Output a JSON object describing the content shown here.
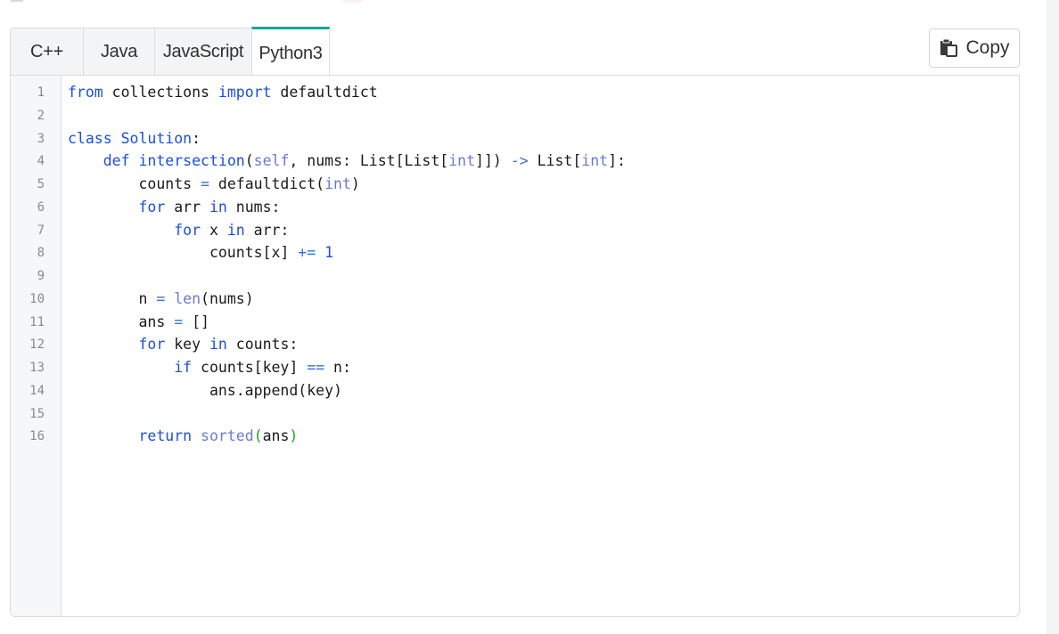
{
  "tabs": [
    {
      "label": "C++",
      "active": false
    },
    {
      "label": "Java",
      "active": false
    },
    {
      "label": "JavaScript",
      "active": false
    },
    {
      "label": "Python3",
      "active": true
    }
  ],
  "copy_button": {
    "label": "Copy",
    "icon": "clipboard-copy-icon"
  },
  "colors": {
    "accent_tab": "#1aa3a3",
    "keyword": "#1c4fd8",
    "builtin": "#6b79d6",
    "bracket_match": "#1ba21b"
  },
  "code": {
    "language": "Python3",
    "lines": [
      [
        {
          "t": "from",
          "c": "kw"
        },
        {
          "t": " collections ",
          "c": "plain"
        },
        {
          "t": "import",
          "c": "kw"
        },
        {
          "t": " defaultdict",
          "c": "plain"
        }
      ],
      [],
      [
        {
          "t": "class",
          "c": "kw"
        },
        {
          "t": " ",
          "c": "plain"
        },
        {
          "t": "Solution",
          "c": "kw"
        },
        {
          "t": ":",
          "c": "plain"
        }
      ],
      [
        {
          "t": "    ",
          "c": "plain"
        },
        {
          "t": "def",
          "c": "kw"
        },
        {
          "t": " ",
          "c": "plain"
        },
        {
          "t": "intersection",
          "c": "kw"
        },
        {
          "t": "(",
          "c": "plain"
        },
        {
          "t": "self",
          "c": "self"
        },
        {
          "t": ", nums: List[List[",
          "c": "plain"
        },
        {
          "t": "int",
          "c": "bi"
        },
        {
          "t": "]]) ",
          "c": "plain"
        },
        {
          "t": "->",
          "c": "op"
        },
        {
          "t": " List[",
          "c": "plain"
        },
        {
          "t": "int",
          "c": "bi"
        },
        {
          "t": "]:",
          "c": "plain"
        }
      ],
      [
        {
          "t": "        counts ",
          "c": "plain"
        },
        {
          "t": "=",
          "c": "op"
        },
        {
          "t": " defaultdict(",
          "c": "plain"
        },
        {
          "t": "int",
          "c": "bi"
        },
        {
          "t": ")",
          "c": "plain"
        }
      ],
      [
        {
          "t": "        ",
          "c": "plain"
        },
        {
          "t": "for",
          "c": "kw"
        },
        {
          "t": " arr ",
          "c": "plain"
        },
        {
          "t": "in",
          "c": "kw"
        },
        {
          "t": " nums:",
          "c": "plain"
        }
      ],
      [
        {
          "t": "            ",
          "c": "plain"
        },
        {
          "t": "for",
          "c": "kw"
        },
        {
          "t": " x ",
          "c": "plain"
        },
        {
          "t": "in",
          "c": "kw"
        },
        {
          "t": " arr:",
          "c": "plain"
        }
      ],
      [
        {
          "t": "                counts[x] ",
          "c": "plain"
        },
        {
          "t": "+=",
          "c": "op"
        },
        {
          "t": " ",
          "c": "plain"
        },
        {
          "t": "1",
          "c": "num"
        }
      ],
      [],
      [
        {
          "t": "        n ",
          "c": "plain"
        },
        {
          "t": "=",
          "c": "op"
        },
        {
          "t": " ",
          "c": "plain"
        },
        {
          "t": "len",
          "c": "bi"
        },
        {
          "t": "(nums)",
          "c": "plain"
        }
      ],
      [
        {
          "t": "        ans ",
          "c": "plain"
        },
        {
          "t": "=",
          "c": "op"
        },
        {
          "t": " []",
          "c": "plain"
        }
      ],
      [
        {
          "t": "        ",
          "c": "plain"
        },
        {
          "t": "for",
          "c": "kw"
        },
        {
          "t": " key ",
          "c": "plain"
        },
        {
          "t": "in",
          "c": "kw"
        },
        {
          "t": " counts:",
          "c": "plain"
        }
      ],
      [
        {
          "t": "            ",
          "c": "plain"
        },
        {
          "t": "if",
          "c": "kw"
        },
        {
          "t": " counts[key] ",
          "c": "plain"
        },
        {
          "t": "==",
          "c": "op"
        },
        {
          "t": " n:",
          "c": "plain"
        }
      ],
      [
        {
          "t": "                ans.append(key)",
          "c": "plain"
        }
      ],
      [],
      [
        {
          "t": "        ",
          "c": "plain"
        },
        {
          "t": "return",
          "c": "kw"
        },
        {
          "t": " ",
          "c": "plain"
        },
        {
          "t": "sorted",
          "c": "bi"
        },
        {
          "t": "(",
          "c": "pgreen"
        },
        {
          "t": "ans",
          "c": "plain"
        },
        {
          "t": ")",
          "c": "pgreen"
        }
      ]
    ]
  }
}
